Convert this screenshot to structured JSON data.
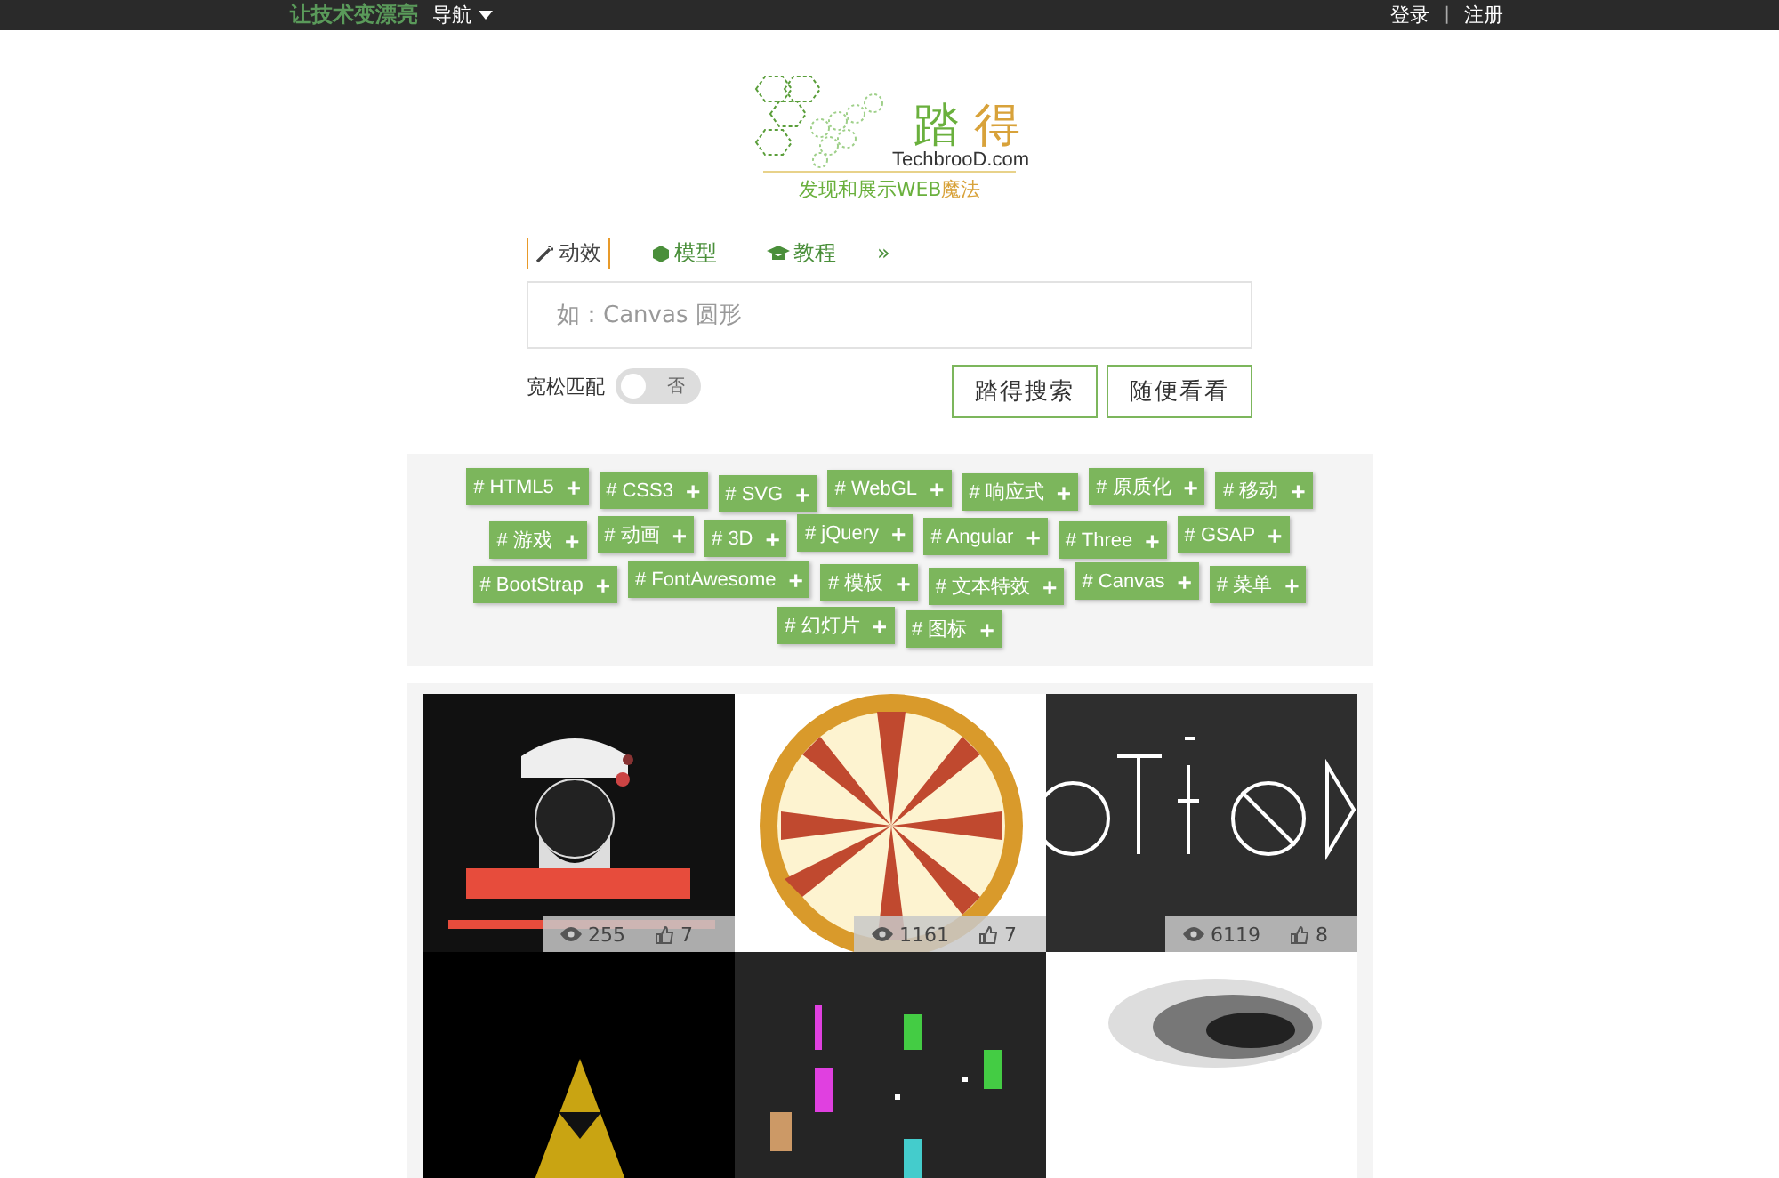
{
  "topbar": {
    "brand": "让技术变漂亮",
    "nav": "导航",
    "login": "登录",
    "separator": "|",
    "register": "注册"
  },
  "logo": {
    "title_1": "踏",
    "title_2": "得",
    "domain": "TechbrooD.com",
    "slogan_1": "发现和展示WEB",
    "slogan_2": "魔法"
  },
  "tabs": [
    {
      "label": "动效",
      "selected": true
    },
    {
      "label": "模型",
      "selected": false
    },
    {
      "label": "教程",
      "selected": false
    }
  ],
  "more": "»",
  "search": {
    "placeholder": "如：Canvas 圆形"
  },
  "loose_match": {
    "label": "宽松匹配",
    "on": false,
    "state_text": "否"
  },
  "buttons": [
    "踏得搜索",
    "随便看看"
  ],
  "tags": [
    {
      "label": "# HTML5"
    },
    {
      "label": "# CSS3"
    },
    {
      "label": "# SVG"
    },
    {
      "label": "# WebGL"
    },
    {
      "label": "# 响应式"
    },
    {
      "label": "# 原质化"
    },
    {
      "label": "# 移动"
    },
    {
      "label": "# 游戏"
    },
    {
      "label": "# 动画"
    },
    {
      "label": "# 3D"
    },
    {
      "label": "# jQuery"
    },
    {
      "label": "# Angular"
    },
    {
      "label": "# Three"
    },
    {
      "label": "# GSAP"
    },
    {
      "label": "# BootStrap"
    },
    {
      "label": "# FontAwesome"
    },
    {
      "label": "# 模板"
    },
    {
      "label": "# 文本特效"
    },
    {
      "label": "# Canvas"
    },
    {
      "label": "# 菜单"
    },
    {
      "label": "# 幻灯片"
    },
    {
      "label": "# 图标"
    }
  ],
  "tag_add": "+",
  "cards": [
    {
      "kind": "picture",
      "views": "255",
      "likes": "7"
    },
    {
      "kind": "picture",
      "views": "1161",
      "likes": "7"
    },
    {
      "kind": "picture",
      "views": "6119",
      "likes": "8"
    },
    {
      "kind": "picture"
    },
    {
      "kind": "picture"
    },
    {
      "kind": "picture"
    }
  ]
}
